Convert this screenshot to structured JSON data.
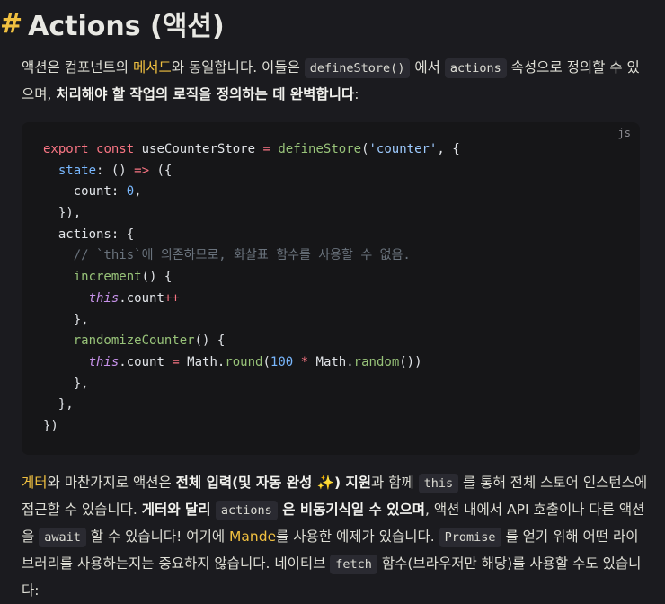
{
  "heading": {
    "hash": "#",
    "title": "Actions (액션)"
  },
  "intro": {
    "t1": "액션은 컴포넌트의 ",
    "hl1": "메서드",
    "t2": "와 동일합니다. 이들은 ",
    "code1": "defineStore()",
    "t3": " 에서 ",
    "code2": "actions",
    "t4": " 속성으로 정의할 수 있으며, ",
    "bold1": "처리해야 할 작업의 로직을 정의하는 데 완벽합니다",
    "t5": ":"
  },
  "codeblock": {
    "lang": "js",
    "lines": {
      "l1": {
        "a": "export",
        "b": " ",
        "c": "const",
        "d": " useCounterStore ",
        "e": "=",
        "f": " ",
        "g": "defineStore",
        "h": "(",
        "i": "'counter'",
        "j": ", {"
      },
      "l2": {
        "a": "  ",
        "b": "state",
        "c": ": () ",
        "d": "=>",
        "e": " ({"
      },
      "l3": {
        "a": "    count: ",
        "b": "0",
        "c": ","
      },
      "l4": {
        "a": "  }),"
      },
      "l5": {
        "a": "  actions: {"
      },
      "l6": {
        "a": "    // `this`에 의존하므로, 화살표 함수를 사용할 수 없음."
      },
      "l7": {
        "a": "    ",
        "b": "increment",
        "c": "() {"
      },
      "l8": {
        "a": "      ",
        "b": "this",
        "c": ".count",
        "d": "++"
      },
      "l9": {
        "a": "    },"
      },
      "l10": {
        "a": "    ",
        "b": "randomizeCounter",
        "c": "() {"
      },
      "l11": {
        "a": "      ",
        "b": "this",
        "c": ".count ",
        "d": "=",
        "e": " Math.",
        "f": "round",
        "g": "(",
        "h": "100",
        "i": " ",
        "j": "*",
        "k": " Math.",
        "l": "random",
        "m": "())"
      },
      "l12": {
        "a": "    },"
      },
      "l13": {
        "a": "  },"
      },
      "l14": {
        "a": "})"
      }
    }
  },
  "second": {
    "hl1": "게터",
    "t1": "와 마찬가지로 액션은 ",
    "bold1": "전체 입력(및 자동 완성 ✨) 지원",
    "t2": "과 함께 ",
    "code1": "this",
    "t3": " 를 통해 전체 스토어 인스턴스에 접근할 수 있습니다. ",
    "bold2": "게터와 달리 ",
    "code2": "actions",
    "bold3": " 은 비동기식일 수 있으며",
    "t4": ", 액션 내에서 API 호출이나 다른 액션을 ",
    "code3": "await",
    "t5": " 할 수 있습니다! 여기에 ",
    "hl2": "Mande",
    "t6": "를 사용한 예제가 있습니다. ",
    "code4": "Promise",
    "t7": " 를 얻기 위해 어떤 라이브러리를 사용하는지는 중요하지 않습니다. 네이티브 ",
    "code5": "fetch",
    "t8": " 함수(브라우저만 해당)를 사용할 수도 있습니다:"
  }
}
